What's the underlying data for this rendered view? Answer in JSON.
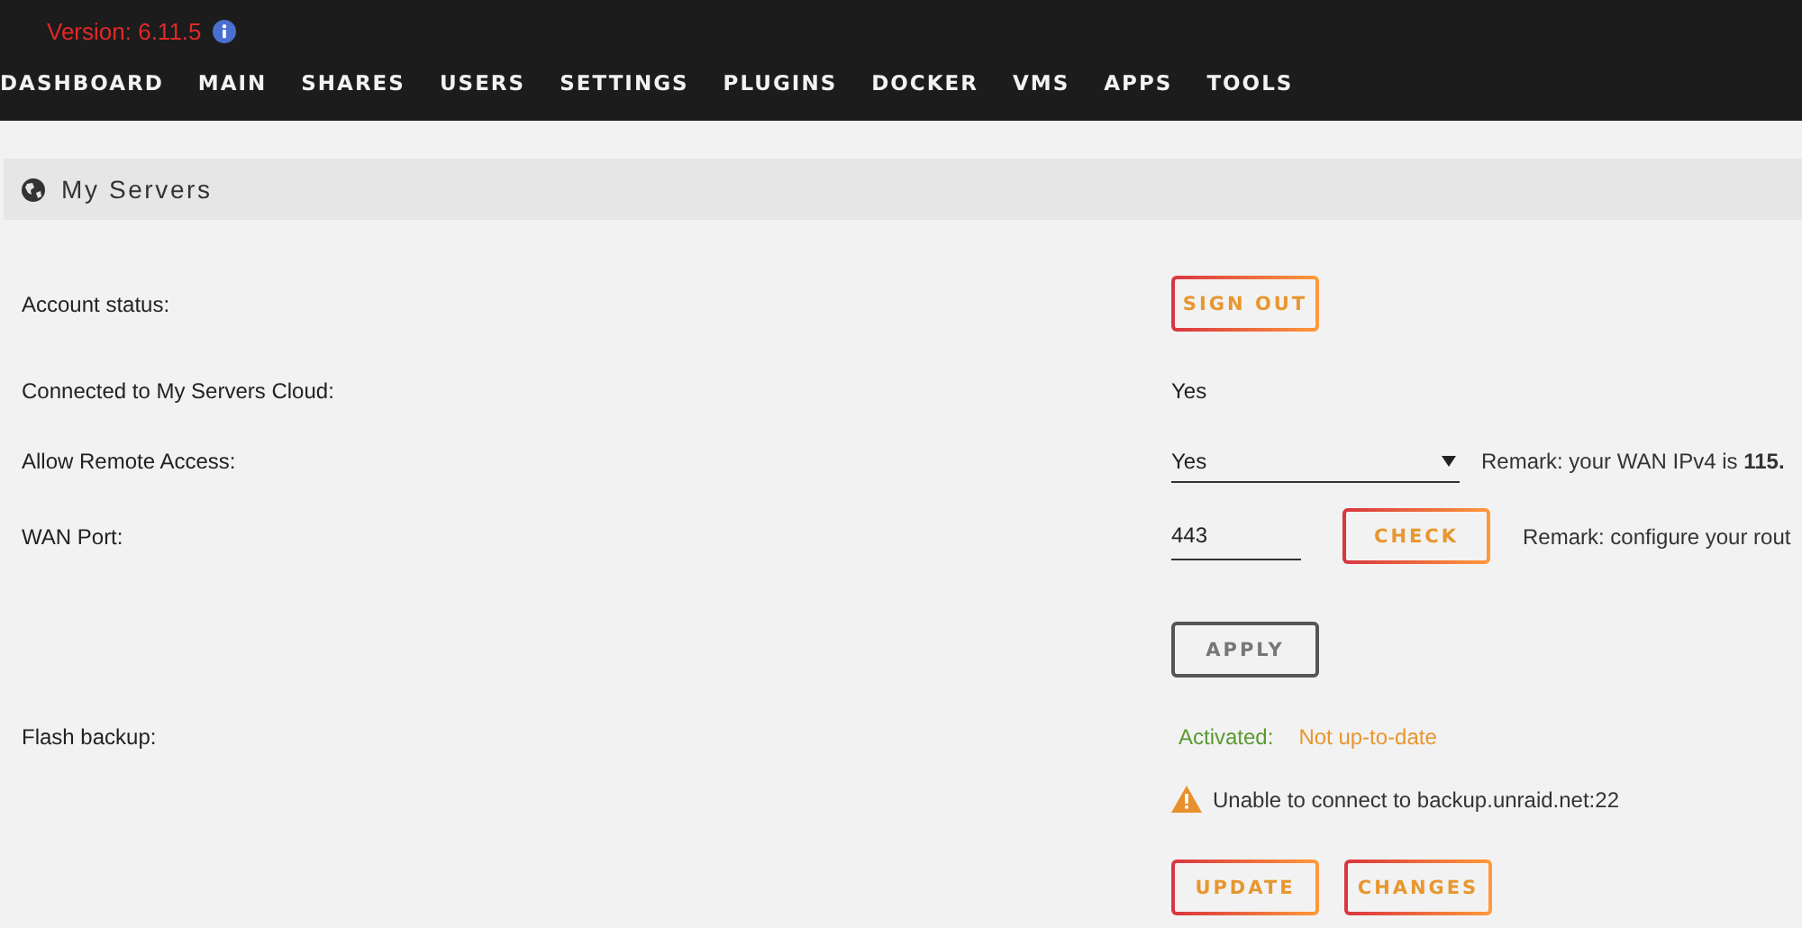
{
  "header": {
    "version": "Version: 6.11.5"
  },
  "nav": [
    {
      "label": "DASHBOARD"
    },
    {
      "label": "MAIN"
    },
    {
      "label": "SHARES"
    },
    {
      "label": "USERS"
    },
    {
      "label": "SETTINGS"
    },
    {
      "label": "PLUGINS"
    },
    {
      "label": "DOCKER"
    },
    {
      "label": "VMS"
    },
    {
      "label": "APPS"
    },
    {
      "label": "TOOLS"
    }
  ],
  "section": {
    "title": "My Servers"
  },
  "rows": [
    {
      "kind": "buttons",
      "label": "Account status:",
      "buttons": [
        {
          "label": "SIGN OUT",
          "kind": "accent"
        }
      ]
    },
    {
      "kind": "text",
      "label": "Connected to My Servers Cloud:",
      "value": "Yes"
    },
    {
      "kind": "select",
      "label": "Allow Remote Access:",
      "value": "Yes",
      "remark": "Remark: your WAN IPv4 is **115.**"
    },
    {
      "kind": "input",
      "label": "WAN Port:",
      "value": "443",
      "button": {
        "label": "CHECK",
        "kind": "accent"
      },
      "remark": "Remark: configure your rout"
    },
    {
      "kind": "buttons",
      "buttons": [
        {
          "label": "APPLY",
          "kind": "plain"
        }
      ]
    },
    {
      "kind": "status",
      "label": "Flash backup:",
      "status": [
        {
          "text": "Activated:",
          "color": "#5a9a32"
        },
        {
          "text": "Not up-to-date",
          "color": "#e8962e"
        }
      ]
    },
    {
      "kind": "warning",
      "text": "Unable to connect to backup.unraid.net:22"
    },
    {
      "kind": "buttons",
      "buttons": [
        {
          "label": "UPDATE",
          "kind": "accent"
        },
        {
          "label": "CHANGES",
          "kind": "accent"
        }
      ]
    }
  ]
}
